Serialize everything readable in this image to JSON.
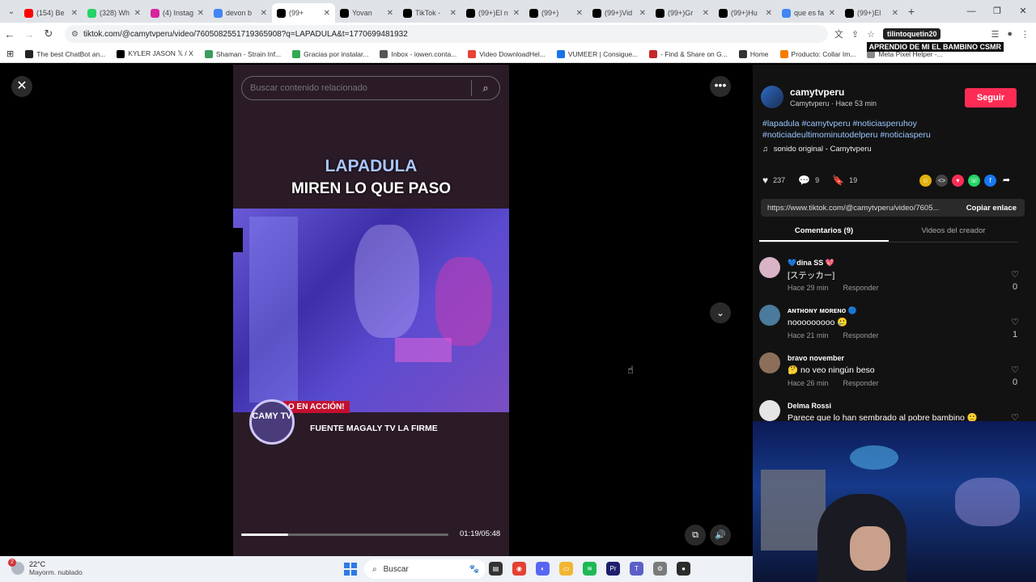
{
  "browser": {
    "tabs": [
      {
        "title": "(154) Be",
        "color": "#ff0000",
        "active": false
      },
      {
        "title": "(328) Wh",
        "color": "#25d366",
        "active": false
      },
      {
        "title": "(4) Instag",
        "color": "#d6249f",
        "active": false
      },
      {
        "title": "devon b",
        "color": "#4285f4",
        "active": false
      },
      {
        "title": "(99+",
        "color": "#000000",
        "active": true
      },
      {
        "title": "Yovan",
        "color": "#000000",
        "active": false
      },
      {
        "title": "TikTok -",
        "color": "#000000",
        "active": false
      },
      {
        "title": "(99+)El n",
        "color": "#000000",
        "active": false
      },
      {
        "title": "(99+)",
        "color": "#000000",
        "active": false
      },
      {
        "title": "(99+)Vid",
        "color": "#000000",
        "active": false
      },
      {
        "title": "(99+)Gr",
        "color": "#000000",
        "active": false
      },
      {
        "title": "(99+)Hu",
        "color": "#000000",
        "active": false
      },
      {
        "title": "que es fa",
        "color": "#4285f4",
        "active": false
      },
      {
        "title": "(99+)El",
        "color": "#000000",
        "active": false
      }
    ],
    "url": "tiktok.com/@camytvperu/video/7605082551719365908?q=LAPADULA&t=1770699481932",
    "profile_name": "tilintoquetin20",
    "stream_banner": "APRENDIO DE MI EL BAMBINO CSMR",
    "bookmarks": [
      {
        "label": "The best ChatBot an...",
        "color": "#222222"
      },
      {
        "label": "KYLER JASON 𝕏 / X",
        "color": "#000000"
      },
      {
        "label": "Shaman - Strain Inf...",
        "color": "#3a9d5d"
      },
      {
        "label": "Gracias por instalar...",
        "color": "#34a853"
      },
      {
        "label": "Inbox - iowen.conta...",
        "color": "#555555"
      },
      {
        "label": "Video DownloadHel...",
        "color": "#e94235"
      },
      {
        "label": "VUMEER | Consigue...",
        "color": "#1a73e8"
      },
      {
        "label": "- Find & Share on G...",
        "color": "#c62828"
      },
      {
        "label": "Home",
        "color": "#333333"
      },
      {
        "label": "Producto: Collar Im...",
        "color": "#f57c00"
      },
      {
        "label": "Meta Pixel Helper -...",
        "color": "#888888"
      }
    ]
  },
  "video": {
    "search_placeholder": "Buscar contenido relacionado",
    "title_line1": "LAPADULA",
    "title_line2": "MIREN LO QUE PASO",
    "logo_text": "CAMY TV",
    "action_tag": "O EN ACCIÓN!",
    "source_caption": "FUENTE MAGALY TV LA FIRME",
    "timecode": "01:19/05:48",
    "progress_fraction": 0.227
  },
  "sidebar": {
    "username": "camytvperu",
    "subline": "Camytvperu · Hace 53 min",
    "follow_label": "Seguir",
    "hashtags": "#lapadula #camytvperu #noticiasperuhoy #noticiadeultimominutodelperu #noticiasperu",
    "sound": "sonido original - Camytvperu",
    "likes": "237",
    "comments_count": "9",
    "saves": "19",
    "link": "https://www.tiktok.com/@camytvperu/video/7605...",
    "copy_label": "Copiar enlace",
    "tab_comments": "Comentarios (9)",
    "tab_videos": "Videos del creador",
    "comments": [
      {
        "user": "💙dina SS 💖",
        "text": "[ステッカー]",
        "time": "Hace 29 min",
        "reply": "Responder",
        "likes": "0",
        "avatar": "#d9b3c6"
      },
      {
        "user": "ᴀɴᴛʜᴏɴʏ ᴍᴏʀᴇɴᴏ 🔵",
        "text": "nooooooooo 🥲",
        "time": "Hace 21 min",
        "reply": "Responder",
        "likes": "1",
        "avatar": "#4a7a9c"
      },
      {
        "user": "bravo november",
        "text": "🤔 no veo ningún beso",
        "time": "Hace 26 min",
        "reply": "Responder",
        "likes": "0",
        "avatar": "#8c6f5a"
      },
      {
        "user": "Delma Rossi",
        "text": "Parece que lo han sembrado al pobre bambino 🙂",
        "time": "",
        "reply": "",
        "likes": "",
        "avatar": "#e5e5e5"
      }
    ]
  },
  "taskbar": {
    "temp": "22°C",
    "weather": "Mayorm. nublado",
    "badge": "2",
    "search_label": "Buscar"
  }
}
